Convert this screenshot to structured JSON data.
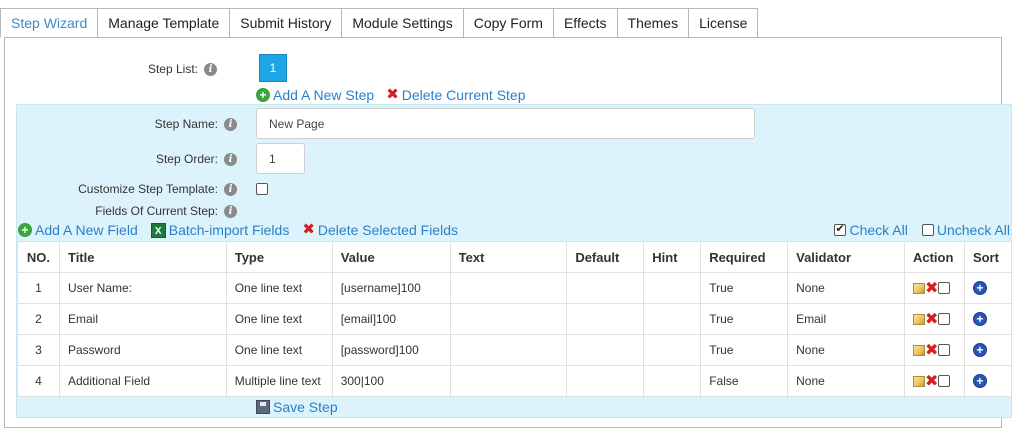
{
  "tabs": [
    {
      "label": "Step Wizard",
      "active": true
    },
    {
      "label": "Manage Template",
      "active": false
    },
    {
      "label": "Submit History",
      "active": false
    },
    {
      "label": "Module Settings",
      "active": false
    },
    {
      "label": "Copy Form",
      "active": false
    },
    {
      "label": "Effects",
      "active": false
    },
    {
      "label": "Themes",
      "active": false
    },
    {
      "label": "License",
      "active": false
    }
  ],
  "step_list": {
    "label": "Step List:",
    "steps": [
      "1"
    ],
    "add_label": "Add A New Step",
    "delete_label": "Delete Current Step"
  },
  "form": {
    "step_name_label": "Step Name:",
    "step_name_value": "New Page",
    "step_order_label": "Step Order:",
    "step_order_value": "1",
    "customize_label": "Customize Step Template:",
    "customize_checked": false,
    "fields_label": "Fields Of Current Step:"
  },
  "field_actions": {
    "add": "Add A New Field",
    "batch": "Batch-import Fields",
    "delete": "Delete Selected Fields",
    "check_all": "Check All",
    "uncheck_all": "Uncheck All"
  },
  "table": {
    "headers": [
      "NO.",
      "Title",
      "Type",
      "Value",
      "Text",
      "Default",
      "Hint",
      "Required",
      "Validator",
      "Action",
      "Sort"
    ],
    "rows": [
      {
        "no": "1",
        "title": "User Name:",
        "type": "One line text",
        "value": "[username]100",
        "text": "",
        "default": "",
        "hint": "",
        "required": "True",
        "validator": "None"
      },
      {
        "no": "2",
        "title": "Email",
        "type": "One line text",
        "value": "[email]100",
        "text": "",
        "default": "",
        "hint": "",
        "required": "True",
        "validator": "Email"
      },
      {
        "no": "3",
        "title": "Password",
        "type": "One line text",
        "value": "[password]100",
        "text": "",
        "default": "",
        "hint": "",
        "required": "True",
        "validator": "None"
      },
      {
        "no": "4",
        "title": "Additional Field",
        "type": "Multiple line text",
        "value": "300|100",
        "text": "",
        "default": "",
        "hint": "",
        "required": "False",
        "validator": "None"
      }
    ]
  },
  "save_label": "Save Step",
  "icons": {
    "info": "info-icon",
    "add": "plus-circle-icon",
    "delete": "red-x-icon",
    "excel": "excel-icon",
    "edit": "edit-icon",
    "sort": "sort-circle-icon",
    "save": "floppy-icon"
  }
}
